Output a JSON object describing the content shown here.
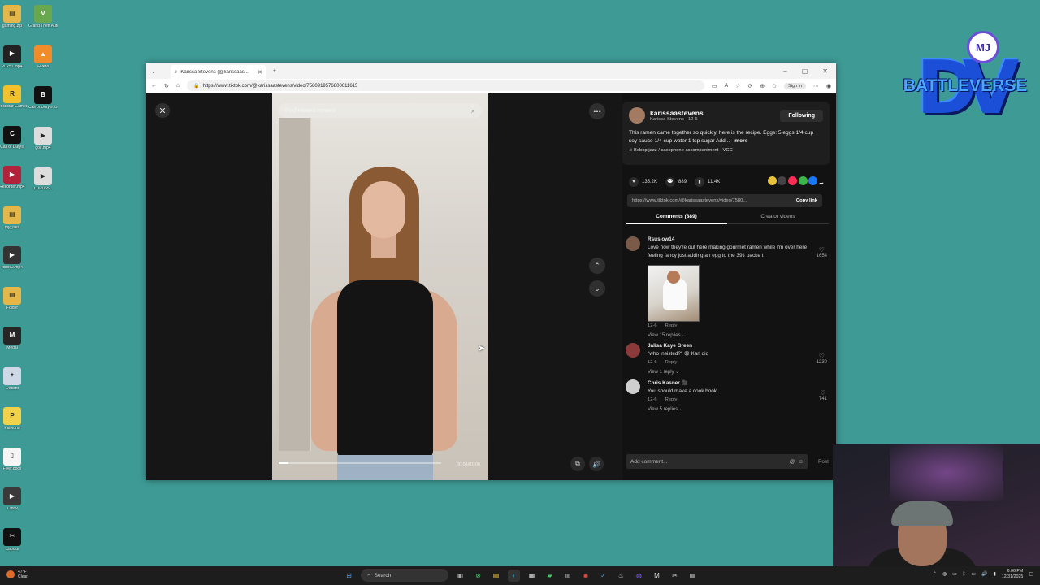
{
  "desktop": {
    "left_column": [
      {
        "label": "gaming.zip",
        "color": "#e3b74a",
        "glyph": "▤"
      },
      {
        "label": "20251.mp4",
        "color": "#222222",
        "glyph": "▶"
      },
      {
        "label": "Rockstar Games...",
        "color": "#f2c12e",
        "glyph": "R"
      },
      {
        "label": "Call of Duty®",
        "color": "#111111",
        "glyph": "C"
      },
      {
        "label": "Recorder.mp4",
        "color": "#b2223a",
        "glyph": "▶"
      },
      {
        "label": "my_files",
        "color": "#e3b74a",
        "glyph": "▤"
      },
      {
        "label": "foloie2.mp4",
        "color": "#333333",
        "glyph": "▶"
      },
      {
        "label": "Folder",
        "color": "#e3b74a",
        "glyph": "▤"
      },
      {
        "label": "Medal",
        "color": "#262626",
        "glyph": "M"
      },
      {
        "label": "Decent",
        "color": "#cfd8e6",
        "glyph": "✦"
      },
      {
        "label": "Palworld",
        "color": "#f2d24a",
        "glyph": "P"
      },
      {
        "label": "Flyer.docx",
        "color": "#f5f5f5",
        "glyph": "▯"
      },
      {
        "label": "1.mov",
        "color": "#3a3a3a",
        "glyph": "▶"
      },
      {
        "label": "CapCut",
        "color": "#111111",
        "glyph": "✂"
      }
    ],
    "right_column": [
      {
        "label": "Grand Theft Auto V L...",
        "color": "#6aa84f",
        "glyph": "V"
      },
      {
        "label": "FiveM",
        "color": "#f08c2a",
        "glyph": "▲"
      },
      {
        "label": "Call of Duty®: Bla...",
        "color": "#111111",
        "glyph": "B"
      },
      {
        "label": "golf.mp4",
        "color": "#dddddd",
        "glyph": "▶"
      },
      {
        "label": "1767065...",
        "color": "#dddddd",
        "glyph": "▶"
      }
    ]
  },
  "logo": {
    "title": "BATTLEVERSE",
    "letters": "DV",
    "badge": "MJ"
  },
  "browser": {
    "tab_title": "Karissa Stevens (@karissaas...",
    "tab_close": "✕",
    "new_tab": "+",
    "url": "https://www.tiktok.com/@karissaastevens/video/7580919576800611615",
    "sign_in": "Sign in",
    "win_controls": [
      "–",
      "▢",
      "✕"
    ]
  },
  "video": {
    "search_placeholder": "Find related content",
    "time": "00:04/01:06",
    "progress": 0.06
  },
  "post": {
    "username": "karissaastevens",
    "display_name": "Karissa Stevens · 12-6",
    "follow_label": "Following",
    "caption": "This ramen came together so quickly, here is the recipe. Eggs: 5 eggs 1/4 cup soy sauce 1/4 cup water 1 tsp sugar Add...",
    "more_label": "more",
    "music": "Bebop jazz / saxophone accompaniment - VCC",
    "likes": "135.2K",
    "comments_count": "889",
    "saves": "11.4K",
    "link": "https://www.tiktok.com/@karissaastevens/video/7580...",
    "copy_link": "Copy link",
    "tab_comments": "Comments (889)",
    "tab_creator": "Creator videos",
    "comment_placeholder": "Add comment...",
    "post_label": "Post"
  },
  "comments": [
    {
      "user": "Rsuslow14",
      "text": "Love how they're out here making gourmet ramen while I'm over here feeling fancy just adding an egg to the 39¢ packe t",
      "date": "12-6",
      "reply": "Reply",
      "likes": "1654",
      "replies": "View 15 replies",
      "avatar": "#7a5a48",
      "has_image": true
    },
    {
      "user": "Jalisa Kaye Green",
      "text": "\"who insisted?\" 😩 Karl did",
      "date": "12-6",
      "reply": "Reply",
      "likes": "1230",
      "replies": "View 1 reply",
      "avatar": "#8a3a3a",
      "has_image": false
    },
    {
      "user": "Chris Kasner 🎥",
      "text": "You should make a cook book",
      "date": "12-6",
      "reply": "Reply",
      "likes": "741",
      "replies": "View 5 replies",
      "avatar": "#cfcfcf",
      "has_image": false
    }
  ],
  "taskbar": {
    "weather_temp": "47°F",
    "weather_desc": "Clear",
    "search_label": "Search",
    "time": "6:06 PM",
    "date": "12/31/2025"
  },
  "colors": {
    "desktop": "#3e9a95",
    "panel": "#121212",
    "accent": "#fe2c55"
  }
}
